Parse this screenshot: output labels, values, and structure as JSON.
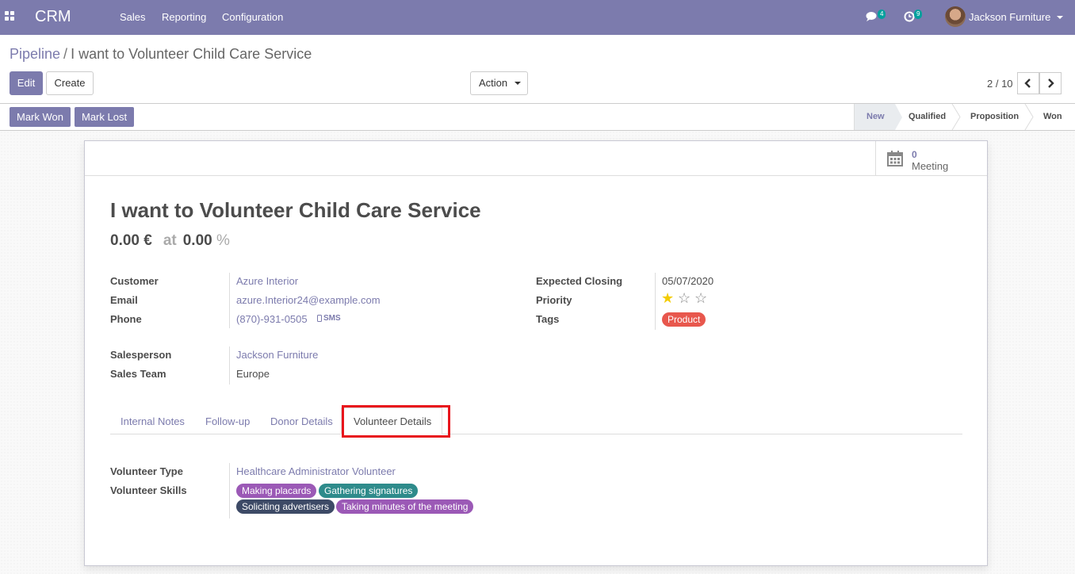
{
  "navbar": {
    "app_name": "CRM",
    "menu": [
      "Sales",
      "Reporting",
      "Configuration"
    ],
    "messages_badge": "4",
    "activities_badge": "9",
    "user_name": "Jackson Furniture",
    "bg_color": "#7c7bad"
  },
  "breadcrumb": {
    "parent": "Pipeline",
    "separator": "/",
    "current": "I want to Volunteer Child Care Service"
  },
  "buttons": {
    "edit": "Edit",
    "create": "Create",
    "action": "Action",
    "mark_won": "Mark Won",
    "mark_lost": "Mark Lost"
  },
  "pager": {
    "value": "2 / 10"
  },
  "stages": [
    {
      "label": "New",
      "active": true
    },
    {
      "label": "Qualified",
      "active": false
    },
    {
      "label": "Proposition",
      "active": false
    },
    {
      "label": "Won",
      "active": false
    }
  ],
  "stat_button": {
    "value": "0",
    "text": "Meeting",
    "icon": "calendar-icon"
  },
  "lead": {
    "title": "I want to Volunteer Child Care Service",
    "expected_revenue": "0.00 €",
    "at": "at",
    "probability": "0.00",
    "probability_unit": "%"
  },
  "fields": {
    "customer_label": "Customer",
    "customer": "Azure Interior",
    "email_label": "Email",
    "email": "azure.Interior24@example.com",
    "phone_label": "Phone",
    "phone": "(870)-931-0505",
    "sms": "SMS",
    "salesperson_label": "Salesperson",
    "salesperson": "Jackson Furniture",
    "sales_team_label": "Sales Team",
    "sales_team": "Europe",
    "closing_label": "Expected Closing",
    "closing": "05/07/2020",
    "priority_label": "Priority",
    "priority_stars": 1,
    "priority_max": 3,
    "tags_label": "Tags",
    "tag": "Product",
    "tag_color": "#e8574d"
  },
  "tabs": [
    "Internal Notes",
    "Follow-up",
    "Donor Details",
    "Volunteer Details"
  ],
  "active_tab": "Volunteer Details",
  "volunteer": {
    "type_label": "Volunteer Type",
    "type": "Healthcare Administrator Volunteer",
    "skills_label": "Volunteer Skills",
    "skills": [
      {
        "label": "Making placards",
        "color": "#9b59b6"
      },
      {
        "label": "Gathering signatures",
        "color": "#2e8b8b"
      },
      {
        "label": "Soliciting advertisers",
        "color": "#3d4a66"
      },
      {
        "label": "Taking minutes of the meeting",
        "color": "#9b59b6"
      }
    ]
  }
}
